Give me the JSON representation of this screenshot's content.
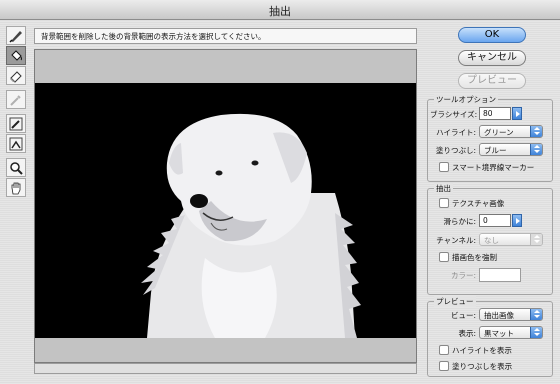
{
  "window": {
    "title": "抽出"
  },
  "toolbar": {
    "tools": [
      {
        "icon": "edge-highlighter-icon",
        "selected": false,
        "disabled": false
      },
      {
        "icon": "fill-bucket-icon",
        "selected": true,
        "disabled": false
      },
      {
        "icon": "eraser-icon",
        "selected": false,
        "disabled": false
      },
      {
        "icon": "eyedropper-icon",
        "selected": false,
        "disabled": true
      },
      {
        "icon": "cleanup-tool-icon",
        "selected": false,
        "disabled": false
      },
      {
        "icon": "edge-touchup-icon",
        "selected": false,
        "disabled": false
      },
      {
        "icon": "zoom-icon",
        "selected": false,
        "disabled": false
      },
      {
        "icon": "hand-icon",
        "selected": false,
        "disabled": false
      }
    ]
  },
  "hint_text": "背景範囲を削除した後の背景範囲の表示方法を選択してください。",
  "buttons": {
    "ok": "OK",
    "cancel": "キャンセル",
    "preview": "プレビュー"
  },
  "tool_options": {
    "title": "ツールオプション",
    "brush_size_label": "ブラシサイズ:",
    "brush_size_value": "80",
    "highlight_label": "ハイライト:",
    "highlight_value": "グリーン",
    "fill_label": "塗りつぶし:",
    "fill_value": "ブルー",
    "smart_edge_label": "スマート境界線マーカー"
  },
  "extraction": {
    "title": "抽出",
    "textured_label": "テクスチャ画像",
    "smooth_label": "滑らかに:",
    "smooth_value": "0",
    "channel_label": "チャンネル:",
    "channel_value": "なし",
    "force_fg_label": "描画色を強制",
    "color_label": "カラー:"
  },
  "preview": {
    "title": "プレビュー",
    "view_label": "ビュー:",
    "view_value": "抽出画像",
    "display_label": "表示:",
    "display_value": "黒マット",
    "show_highlight_label": "ハイライトを表示",
    "show_fill_label": "塗りつぶしを表示"
  },
  "colors": {
    "ok_button": "#6aa6ef",
    "canvas_background": "#000000",
    "matte": "#000000"
  }
}
